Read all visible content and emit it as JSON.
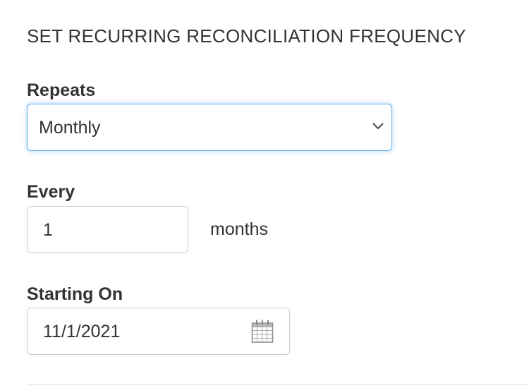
{
  "section": {
    "title": "SET RECURRING RECONCILIATION FREQUENCY"
  },
  "repeats": {
    "label": "Repeats",
    "selected": "Monthly",
    "icon": "chevron-down-icon"
  },
  "every": {
    "label": "Every",
    "value": "1",
    "unit": "months"
  },
  "starting_on": {
    "label": "Starting On",
    "value": "11/1/2021",
    "icon": "calendar-icon"
  },
  "colors": {
    "focus_border": "#66afe9",
    "input_border": "#cccccc",
    "text": "#333333"
  }
}
